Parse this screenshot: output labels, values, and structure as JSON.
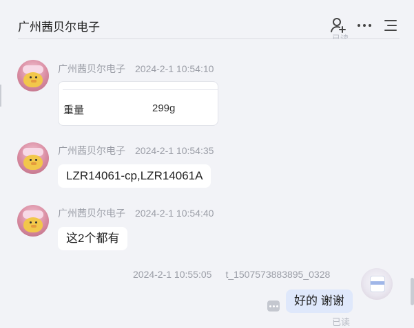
{
  "header": {
    "title": "广州茜贝尔电子",
    "icons": [
      "add-contact-icon",
      "more-icon",
      "menu-list-icon"
    ],
    "clipped_status": "已读"
  },
  "messages": [
    {
      "sender": "广州茜贝尔电子",
      "time": "2024-2-1 10:54:10",
      "type": "card",
      "card": {
        "key": "重量",
        "value": "299g"
      }
    },
    {
      "sender": "广州茜贝尔电子",
      "time": "2024-2-1 10:54:35",
      "type": "text",
      "text": "LZR14061-cp,LZR14061A"
    },
    {
      "sender": "广州茜贝尔电子",
      "time": "2024-2-1 10:54:40",
      "type": "text",
      "text": "这2个都有"
    },
    {
      "sender": "t_1507573883895_0328",
      "time": "2024-2-1 10:55:05",
      "type": "text",
      "mine": true,
      "text": "好的 谢谢",
      "status": "已读"
    }
  ],
  "colors": {
    "background": "#f2f3f7",
    "bubble_other": "#ffffff",
    "bubble_mine": "#dfe8fb",
    "meta_text": "#9a9da6"
  }
}
